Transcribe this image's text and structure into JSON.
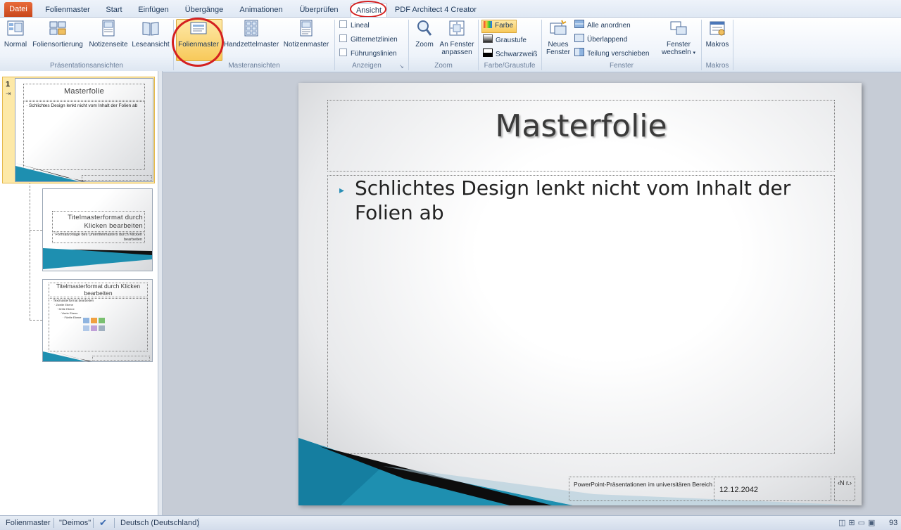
{
  "tabs": [
    {
      "label": "Datei",
      "kind": "file"
    },
    {
      "label": "Folienmaster"
    },
    {
      "label": "Start"
    },
    {
      "label": "Einfügen"
    },
    {
      "label": "Übergänge"
    },
    {
      "label": "Animationen"
    },
    {
      "label": "Überprüfen"
    },
    {
      "label": "Ansicht",
      "active": true,
      "highlighted": true
    },
    {
      "label": "PDF Architect 4 Creator"
    }
  ],
  "ribbon": {
    "praesentationsansichten": {
      "label": "Präsentationsansichten",
      "buttons": [
        "Normal",
        "Foliensortierung",
        "Notizenseite",
        "Leseansicht"
      ]
    },
    "masteransichten": {
      "label": "Masteransichten",
      "buttons": [
        {
          "label": "Folienmaster",
          "selected": true,
          "highlighted": true
        },
        {
          "label": "Handzettelmaster"
        },
        {
          "label": "Notizenmaster"
        }
      ]
    },
    "anzeigen": {
      "label": "Anzeigen",
      "checkboxes": [
        {
          "label": "Lineal",
          "checked": false
        },
        {
          "label": "Gitternetzlinien",
          "checked": false
        },
        {
          "label": "Führungslinien",
          "checked": false
        }
      ]
    },
    "zoom": {
      "label": "Zoom",
      "zoom_button": "Zoom",
      "fit_button_line1": "An Fenster",
      "fit_button_line2": "anpassen"
    },
    "farbe": {
      "label": "Farbe/Graustufe",
      "options": [
        {
          "label": "Farbe",
          "selected": true
        },
        {
          "label": "Graustufe"
        },
        {
          "label": "Schwarzweiß"
        }
      ]
    },
    "fenster": {
      "label": "Fenster",
      "new_window_line1": "Neues",
      "new_window_line2": "Fenster",
      "items": [
        "Alle anordnen",
        "Überlappend",
        "Teilung verschieben"
      ],
      "switch_line1": "Fenster",
      "switch_line2": "wechseln"
    },
    "makros": {
      "label": "Makros",
      "button": "Makros"
    }
  },
  "thumbnails": {
    "t1": {
      "number": "1",
      "title": "Masterfolie",
      "body": "Schlichtes Design lenkt nicht vom Inhalt der Folien ab"
    },
    "t2": {
      "title": "Titelmasterformat durch Klicken bearbeiten",
      "subtitle": "Formatvorlage des Untertitelmasters durch Klicken bearbeiten"
    },
    "t3": {
      "title": "Titelmasterformat durch Klicken bearbeiten",
      "levels": [
        "Textmasterformat bearbeiten",
        "Zweite Ebene",
        "Dritte Ebene",
        "Vierte Ebene",
        "Fünfte Ebene"
      ]
    }
  },
  "slide": {
    "title": "Masterfolie",
    "bullet": "Schlichtes Design lenkt nicht vom Inhalt der Folien ab",
    "footer": "PowerPoint-Präsentationen im universitären Bereich",
    "date": "12.12.2042",
    "number": "‹N r.›"
  },
  "status": {
    "view": "Folienmaster",
    "theme": "\"Deimos\"",
    "language": "Deutsch (Deutschland)",
    "zoom": "93"
  },
  "colors": {
    "accent_blue": "#1e8fb0",
    "file_tab": "#d9582b",
    "highlight_ring": "#d42020",
    "selected_button": "#fbd56a"
  }
}
